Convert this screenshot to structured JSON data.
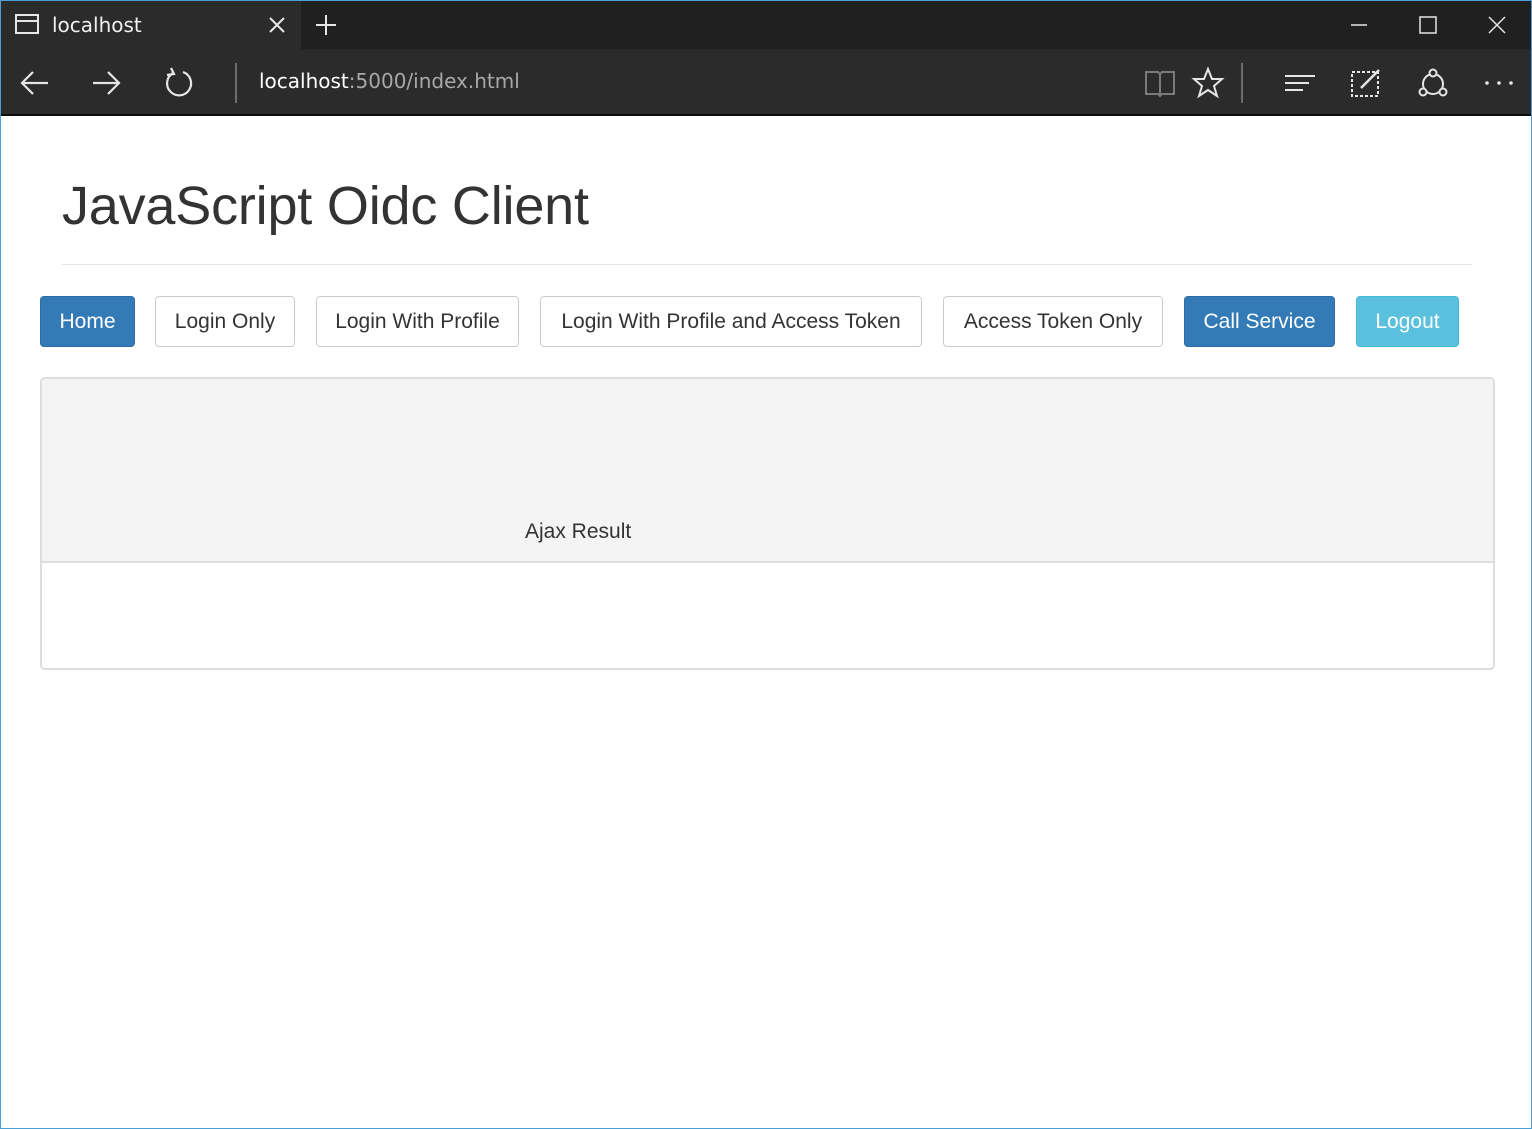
{
  "browser": {
    "tab_title": "localhost",
    "url_host": "localhost",
    "url_rest": ":5000/index.html",
    "colors": {
      "chrome": "#2b2b2b",
      "tabstrip": "#202020",
      "frame": "#4a9fd8"
    }
  },
  "page": {
    "title": "JavaScript Oidc Client",
    "buttons": {
      "home": "Home",
      "login_only": "Login Only",
      "login_with_profile": "Login With Profile",
      "login_with_profile_and_token": "Login With Profile and Access Token",
      "access_token_only": "Access Token Only",
      "call_service": "Call Service",
      "logout": "Logout"
    },
    "panel": {
      "title": "Ajax Result",
      "body": ""
    },
    "colors": {
      "primary": "#337ab7",
      "info": "#5bc0de",
      "default_border": "#cccccc"
    }
  }
}
